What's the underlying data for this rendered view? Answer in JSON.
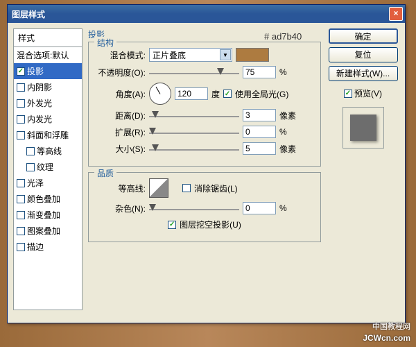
{
  "title": "图层样式",
  "color_hex": "# ad7b40",
  "left": {
    "header": "样式",
    "items": [
      {
        "label": "混合选项:默认",
        "checked": null
      },
      {
        "label": "投影",
        "checked": true,
        "selected": true
      },
      {
        "label": "内阴影",
        "checked": false
      },
      {
        "label": "外发光",
        "checked": false
      },
      {
        "label": "内发光",
        "checked": false
      },
      {
        "label": "斜面和浮雕",
        "checked": false
      },
      {
        "label": "等高线",
        "checked": false,
        "indent": true
      },
      {
        "label": "纹理",
        "checked": false,
        "indent": true
      },
      {
        "label": "光泽",
        "checked": false
      },
      {
        "label": "颜色叠加",
        "checked": false
      },
      {
        "label": "渐变叠加",
        "checked": false
      },
      {
        "label": "图案叠加",
        "checked": false
      },
      {
        "label": "描边",
        "checked": false
      }
    ]
  },
  "section_title": "投影",
  "structure": {
    "legend": "结构",
    "blend_mode_label": "混合模式:",
    "blend_mode_value": "正片叠底",
    "opacity_label": "不透明度(O):",
    "opacity_value": "75",
    "opacity_unit": "%",
    "angle_label": "角度(A):",
    "angle_value": "120",
    "angle_unit": "度",
    "global_light": "使用全局光(G)",
    "distance_label": "距离(D):",
    "distance_value": "3",
    "distance_unit": "像素",
    "spread_label": "扩展(R):",
    "spread_value": "0",
    "spread_unit": "%",
    "size_label": "大小(S):",
    "size_value": "5",
    "size_unit": "像素"
  },
  "quality": {
    "legend": "品质",
    "contour_label": "等高线:",
    "antialias": "消除锯齿(L)",
    "noise_label": "杂色(N):",
    "noise_value": "0",
    "noise_unit": "%",
    "knockout": "图层挖空投影(U)"
  },
  "buttons": {
    "ok": "确定",
    "cancel": "复位",
    "new_style": "新建样式(W)...",
    "preview": "预览(V)"
  },
  "watermark": {
    "line1": "中国教程网",
    "line2": "JCWcn.com"
  }
}
